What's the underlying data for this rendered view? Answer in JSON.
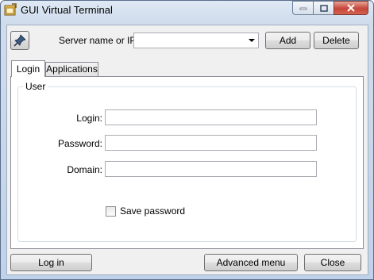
{
  "window": {
    "title": "GUI Virtual Terminal"
  },
  "toolbar": {
    "server_label": "Server name or IP:",
    "server_value": "",
    "add_label": "Add",
    "delete_label": "Delete"
  },
  "tabs": [
    {
      "label": "Login",
      "active": true
    },
    {
      "label": "Applications",
      "active": false
    }
  ],
  "user_group": {
    "title": "User",
    "login_label": "Login:",
    "login_value": "",
    "password_label": "Password:",
    "password_value": "",
    "domain_label": "Domain:",
    "domain_value": "",
    "save_password_label": "Save password",
    "save_password_checked": false
  },
  "footer": {
    "login_button": "Log in",
    "advanced_button": "Advanced menu",
    "close_button": "Close"
  },
  "colors": {
    "close_button": "#c7453a",
    "titlebar": "#cfdcec"
  }
}
